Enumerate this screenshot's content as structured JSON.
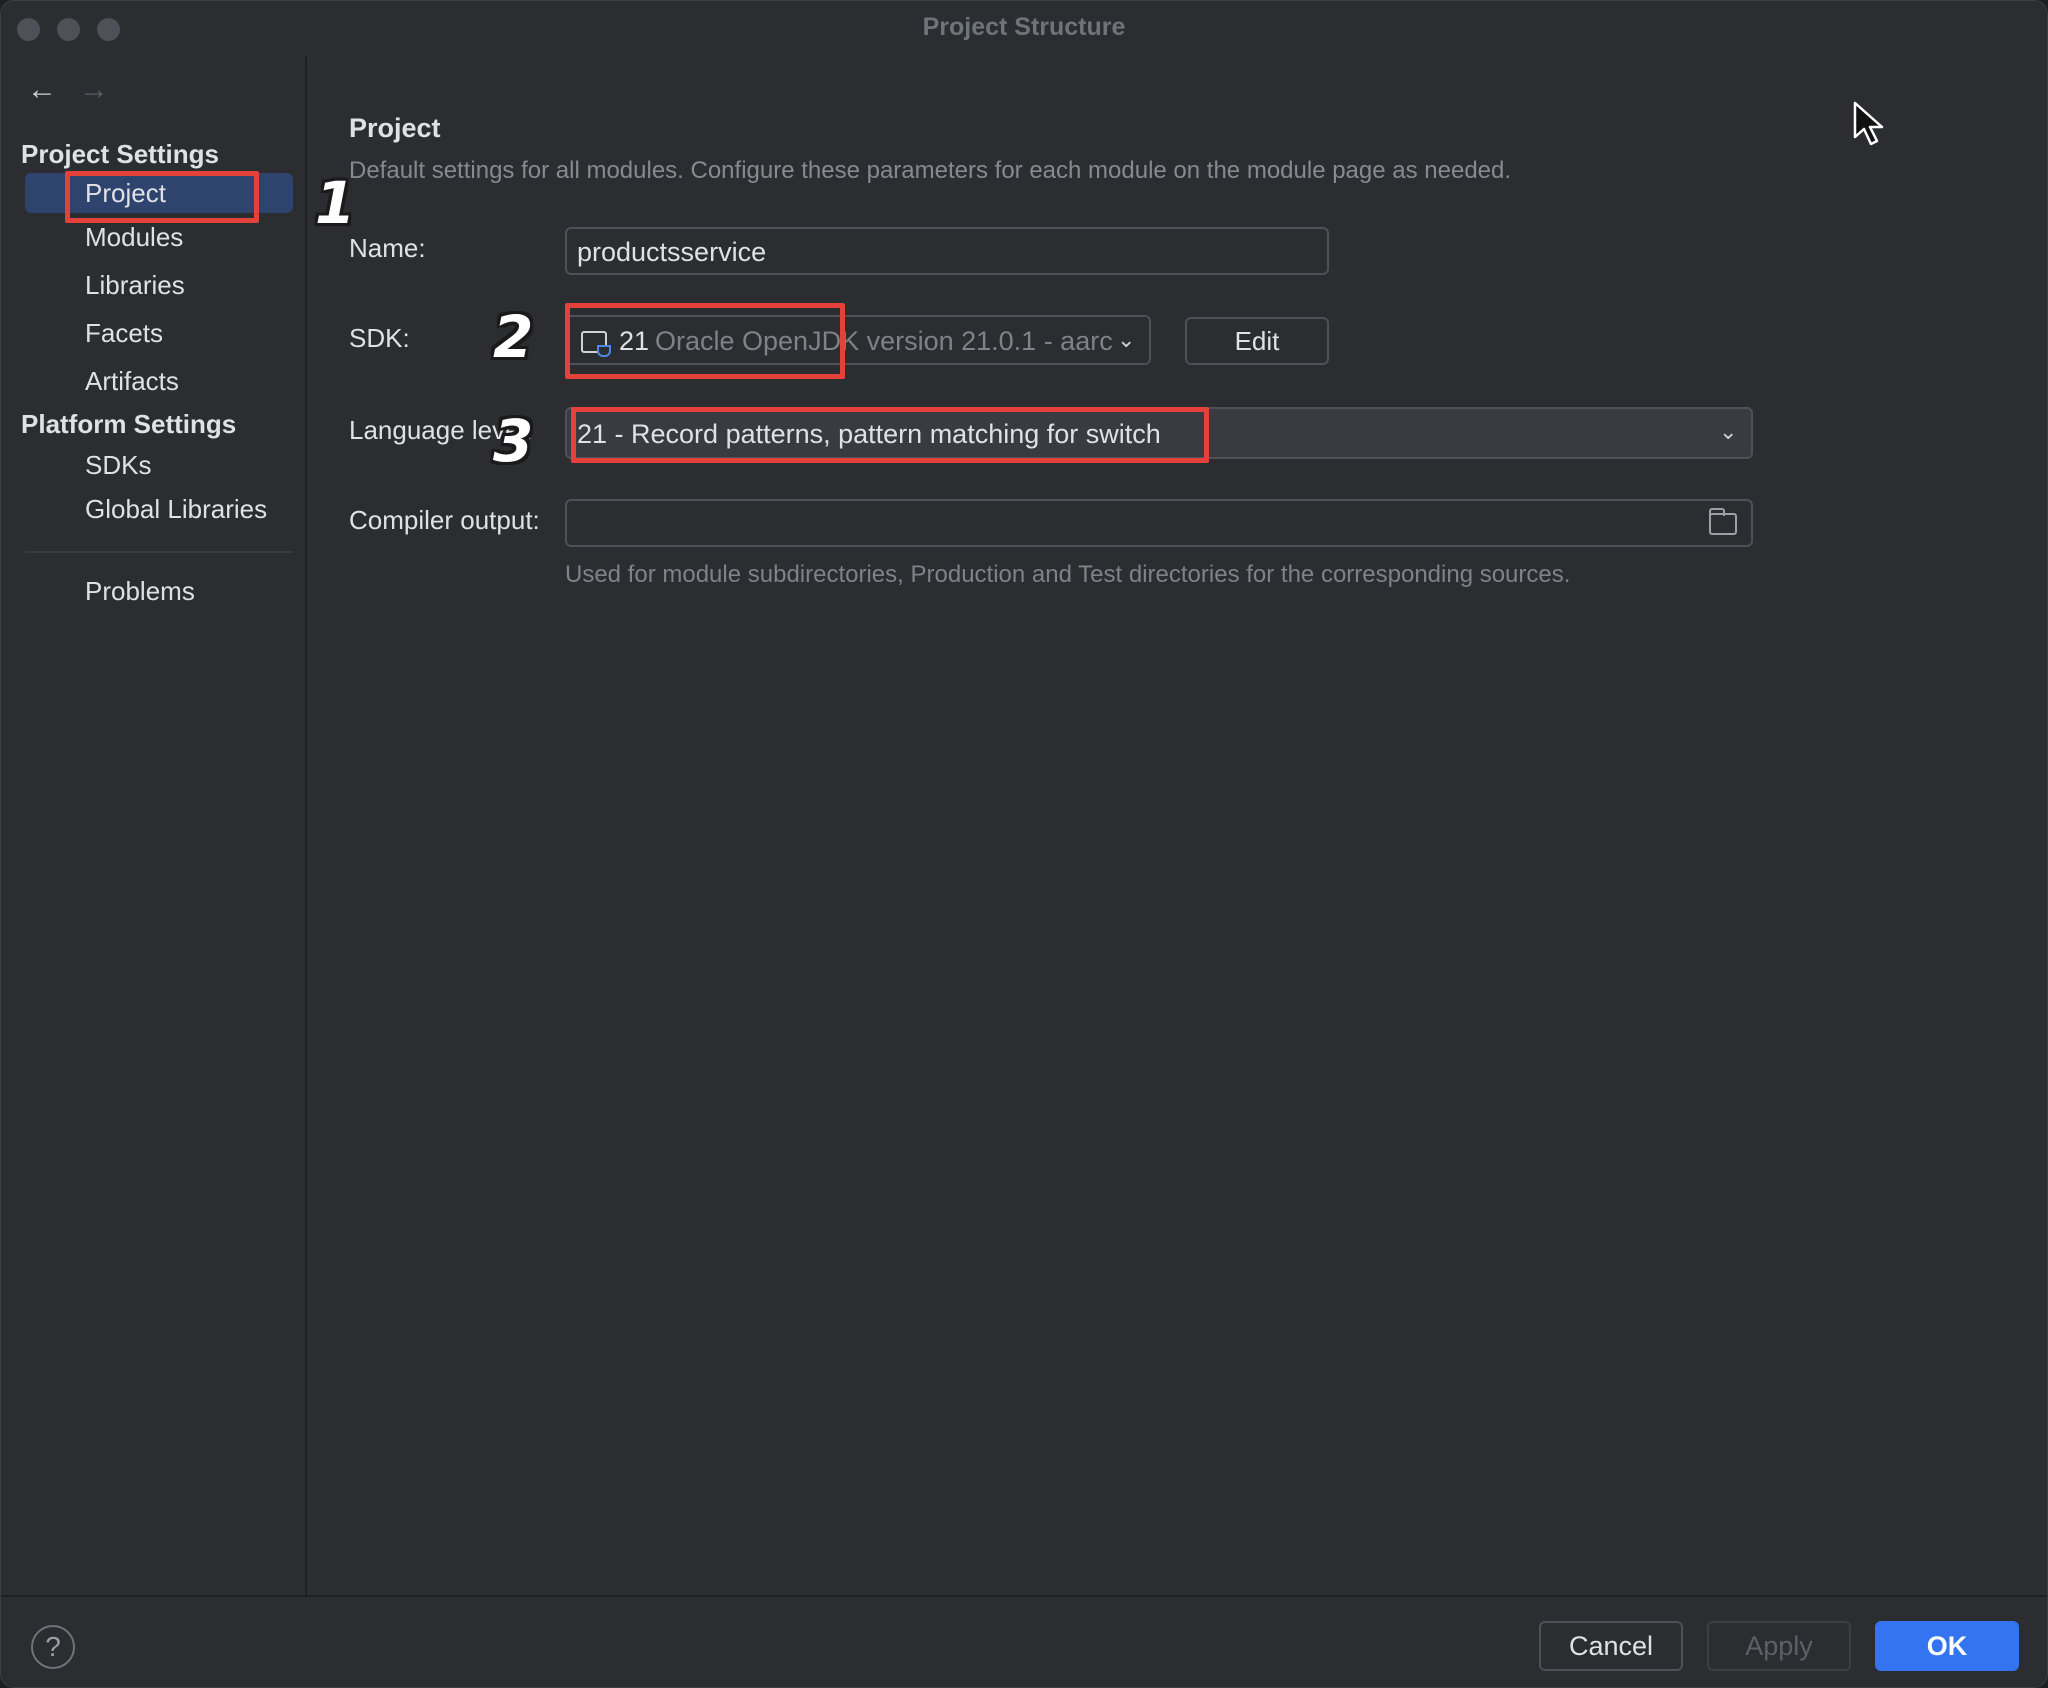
{
  "window": {
    "title": "Project Structure"
  },
  "sidebar": {
    "nav": {
      "back": "←",
      "forward": "→"
    },
    "project_settings_title": "Project Settings",
    "project_items": [
      "Project",
      "Modules",
      "Libraries",
      "Facets",
      "Artifacts"
    ],
    "platform_settings_title": "Platform Settings",
    "platform_items": [
      "SDKs",
      "Global Libraries"
    ],
    "problems": "Problems",
    "selected": "Project"
  },
  "main": {
    "title": "Project",
    "description": "Default settings for all modules. Configure these parameters for each module on the module page as needed.",
    "name_label": "Name:",
    "name_value": "productsservice",
    "sdk_label": "SDK:",
    "sdk_version": "21",
    "sdk_description": "Oracle OpenJDK version 21.0.1 - aarc",
    "edit_button": "Edit",
    "language_label": "Language level:",
    "language_value": "21 - Record patterns, pattern matching for switch",
    "compiler_label": "Compiler output:",
    "compiler_value": "",
    "compiler_hint": "Used for module subdirectories, Production and Test directories for the corresponding sources."
  },
  "annotations": [
    "1",
    "2",
    "3"
  ],
  "footer": {
    "help": "?",
    "cancel": "Cancel",
    "apply": "Apply",
    "ok": "OK"
  },
  "colors": {
    "accent": "#3574f0",
    "selection": "#2e436e",
    "annotation_red": "#e5413b"
  }
}
